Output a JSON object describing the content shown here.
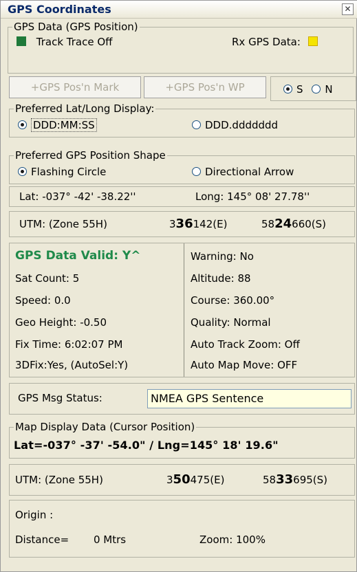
{
  "window": {
    "title": "GPS Coordinates",
    "close_glyph": "✕"
  },
  "gps_data": {
    "legend": "GPS Data (GPS Position)",
    "track_trace": "Track Trace Off",
    "rx_gps_label": "Rx GPS Data:",
    "track_lamp_color": "#1f7a3a",
    "rx_lamp_color": "#f5e400"
  },
  "buttons": {
    "mark": "+GPS Pos'n Mark",
    "wp": "+GPS Pos'n WP"
  },
  "hemisphere": {
    "s": "S",
    "n": "N",
    "selected": "S"
  },
  "latlong_display": {
    "legend": "Preferred Lat/Long Display:",
    "opt1": "DDD:MM:SS",
    "opt2": "DDD.ddddddd",
    "selected": "DDD:MM:SS"
  },
  "shape": {
    "legend": "Preferred GPS Position Shape",
    "opt1": "Flashing Circle",
    "opt2": "Directional Arrow",
    "selected": "Flashing Circle"
  },
  "position": {
    "lat": "Lat: -037° -42' -38.22''",
    "long": "Long: 145° 08' 27.78''"
  },
  "utm_gps": {
    "zone": "UTM: (Zone 55H)",
    "e_pre": "3",
    "e_bold": "36",
    "e_post": "142(E)",
    "n_pre": "58",
    "n_bold": "24",
    "n_post": "660(S)"
  },
  "status": {
    "valid": "GPS Data Valid: Y^",
    "sat_count": "Sat Count: 5",
    "speed": "Speed: 0.0",
    "geo_height": "Geo Height: -0.50",
    "fix_time": "Fix Time: 6:02:07 PM",
    "fix3d": "3DFix:Yes, (AutoSel:Y)",
    "warning": "Warning: No",
    "altitude": "Altitude: 88",
    "course": "Course: 360.00°",
    "quality": "Quality: Normal",
    "auto_track": "Auto Track Zoom: Off",
    "auto_map": "Auto Map Move: OFF",
    "valid_color": "#1f8a4a"
  },
  "msg": {
    "label": "GPS Msg Status:",
    "value": "NMEA GPS Sentence"
  },
  "map_display": {
    "legend": "Map Display Data (Cursor Position)",
    "cursor": "Lat=-037° -37' -54.0\" / Lng=145° 18' 19.6\""
  },
  "utm_cursor": {
    "zone": "UTM: (Zone 55H)",
    "e_pre": "3",
    "e_bold": "50",
    "e_post": "475(E)",
    "n_pre": "58",
    "n_bold": "33",
    "n_post": "695(S)"
  },
  "origin": {
    "label": "Origin :",
    "distance": "Distance=",
    "distance_val": "0 Mtrs",
    "zoom": "Zoom: 100%"
  }
}
